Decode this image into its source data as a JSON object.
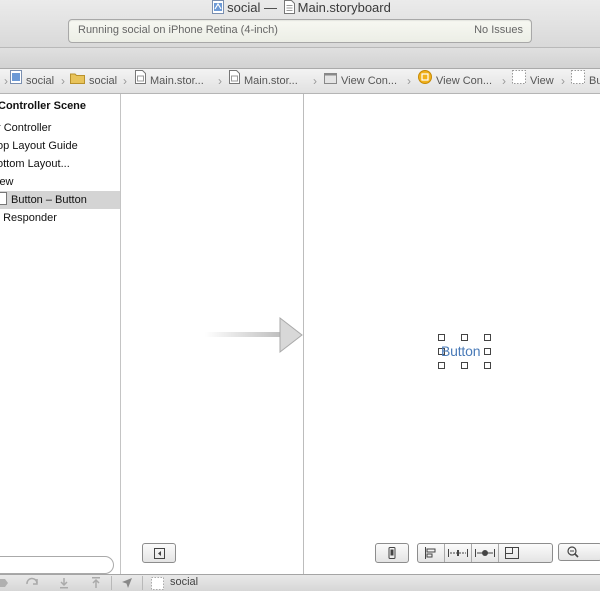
{
  "window": {
    "project": "social",
    "separator": "—",
    "file": "Main.storyboard"
  },
  "activity": {
    "status": "Running social on iPhone Retina (4-inch)",
    "issues": "No Issues"
  },
  "jumpbar": {
    "items": [
      "social",
      "social",
      "Main.stor...",
      "Main.stor...",
      "View Con...",
      "View Con...",
      "View",
      "Bu"
    ]
  },
  "outline": {
    "rows": [
      {
        "label": "Controller Scene"
      },
      {
        "label": "r Controller"
      },
      {
        "label": "op Layout Guide"
      },
      {
        "label": "ottom Layout..."
      },
      {
        "label": "iew"
      },
      {
        "label": "Button – Button"
      },
      {
        "label": "t Responder"
      }
    ]
  },
  "canvas": {
    "button_text": "Button"
  },
  "statusbar": {
    "scheme_name": "social"
  },
  "icons": {
    "project": "xcode-project-icon",
    "folder": "folder-icon",
    "storyboard": "storyboard-icon",
    "scene": "view-controller-icon"
  },
  "colors": {
    "button_text": "#4a7bb8",
    "folder": "#e8c35a",
    "view_controller": "#f1b11c"
  }
}
